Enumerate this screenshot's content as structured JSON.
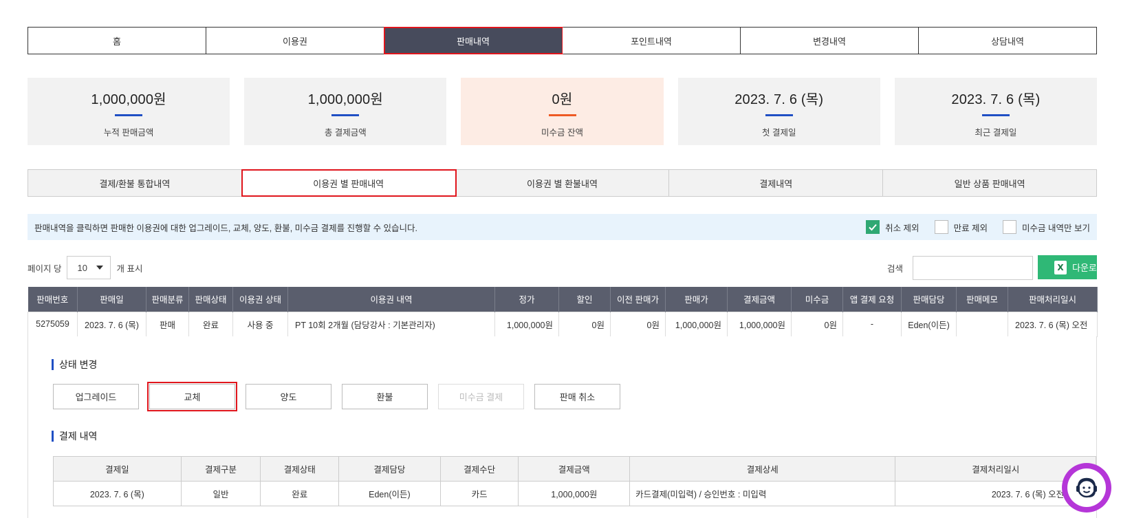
{
  "main_tabs": [
    "홈",
    "이용권",
    "판매내역",
    "포인트내역",
    "변경내역",
    "상담내역"
  ],
  "summary": [
    {
      "value": "1,000,000원",
      "label": "누적 판매금액"
    },
    {
      "value": "1,000,000원",
      "label": "총 결제금액"
    },
    {
      "value": "0원",
      "label": "미수금 잔액"
    },
    {
      "value": "2023. 7. 6 (목)",
      "label": "첫 결제일"
    },
    {
      "value": "2023. 7. 6 (목)",
      "label": "최근 결제일"
    }
  ],
  "sub_tabs": [
    "결제/환불 통합내역",
    "이용권 별 판매내역",
    "이용권 별 환불내역",
    "결제내역",
    "일반 상품 판매내역"
  ],
  "info": {
    "text": "판매내역을 클릭하면 판매한 이용권에 대한 업그레이드, 교체, 양도, 환불, 미수금 결제를 진행할 수 있습니다.",
    "filters": [
      {
        "label": "취소 제외",
        "checked": true
      },
      {
        "label": "만료 제외",
        "checked": false
      },
      {
        "label": "미수금 내역만 보기",
        "checked": false
      }
    ]
  },
  "toolbar": {
    "per_page_label": "페이지 당",
    "per_page_value": "10",
    "per_page_suffix": "개 표시",
    "search_label": "검색",
    "search_placeholder": "",
    "download_label": "다운로드"
  },
  "sales_table": {
    "headers": [
      "판매번호",
      "판매일",
      "판매분류",
      "판매상태",
      "이용권 상태",
      "이용권 내역",
      "정가",
      "할인",
      "이전 판매가",
      "판매가",
      "결제금액",
      "미수금",
      "앱 결제 요청",
      "판매담당",
      "판매메모",
      "판매처리일시"
    ],
    "row": [
      "5275059",
      "2023. 7. 6 (목)",
      "판매",
      "완료",
      "사용 중",
      "PT 10회 2개월 (담당강사 : 기본관리자)",
      "1,000,000원",
      "0원",
      "0원",
      "1,000,000원",
      "1,000,000원",
      "0원",
      "-",
      "Eden(이든)",
      "",
      "2023. 7. 6 (목) 오전"
    ]
  },
  "detail": {
    "status_title": "상태 변경",
    "actions": [
      {
        "label": "업그레이드",
        "enabled": true
      },
      {
        "label": "교체",
        "enabled": true
      },
      {
        "label": "양도",
        "enabled": true
      },
      {
        "label": "환불",
        "enabled": true
      },
      {
        "label": "미수금 결제",
        "enabled": false
      },
      {
        "label": "판매 취소",
        "enabled": true
      }
    ],
    "payment_title": "결제 내역",
    "payment_headers": [
      "결제일",
      "결제구분",
      "결제상태",
      "결제담당",
      "결제수단",
      "결제금액",
      "결제상세",
      "결제처리일시"
    ],
    "payment_row": [
      "2023. 7. 6 (목)",
      "일반",
      "완료",
      "Eden(이든)",
      "카드",
      "1,000,000원",
      "카드결제(미입력) / 승인번호 : 미입력",
      "2023. 7. 6 (목) 오전 9:48"
    ]
  },
  "colors": {
    "active_tab": "#474b5c",
    "highlight": "#e0151c",
    "accent_blue": "#1f4fc4",
    "accent_orange": "#ee5a24",
    "green": "#2fa873",
    "chatbot": "#b536d8"
  },
  "icons": [
    "check-icon",
    "chevron-down-icon",
    "excel-icon",
    "chatbot-icon"
  ]
}
